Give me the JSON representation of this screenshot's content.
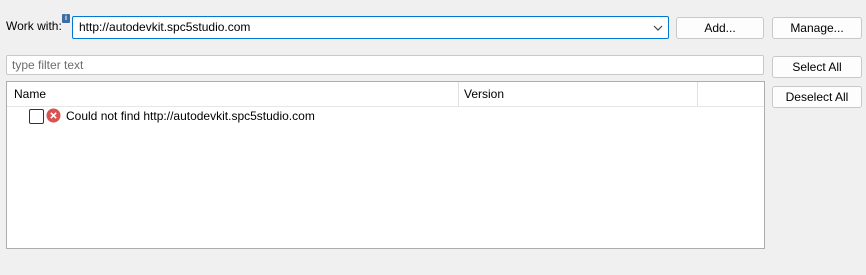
{
  "work_with": {
    "label": "Work with:",
    "info_icon": "info-icon",
    "url_value": "http://autodevkit.spc5studio.com"
  },
  "buttons": {
    "add": "Add...",
    "manage": "Manage...",
    "select_all": "Select All",
    "deselect_all": "Deselect All"
  },
  "filter": {
    "placeholder": "type filter text"
  },
  "table": {
    "columns": [
      "Name",
      "Version"
    ],
    "rows": [
      {
        "checked": false,
        "icon": "error-icon",
        "name": "Could not find http://autodevkit.spc5studio.com",
        "version": ""
      }
    ]
  },
  "colors": {
    "focus_border": "#0078d4",
    "error_red": "#d9534f",
    "background": "#f0f0f0"
  }
}
